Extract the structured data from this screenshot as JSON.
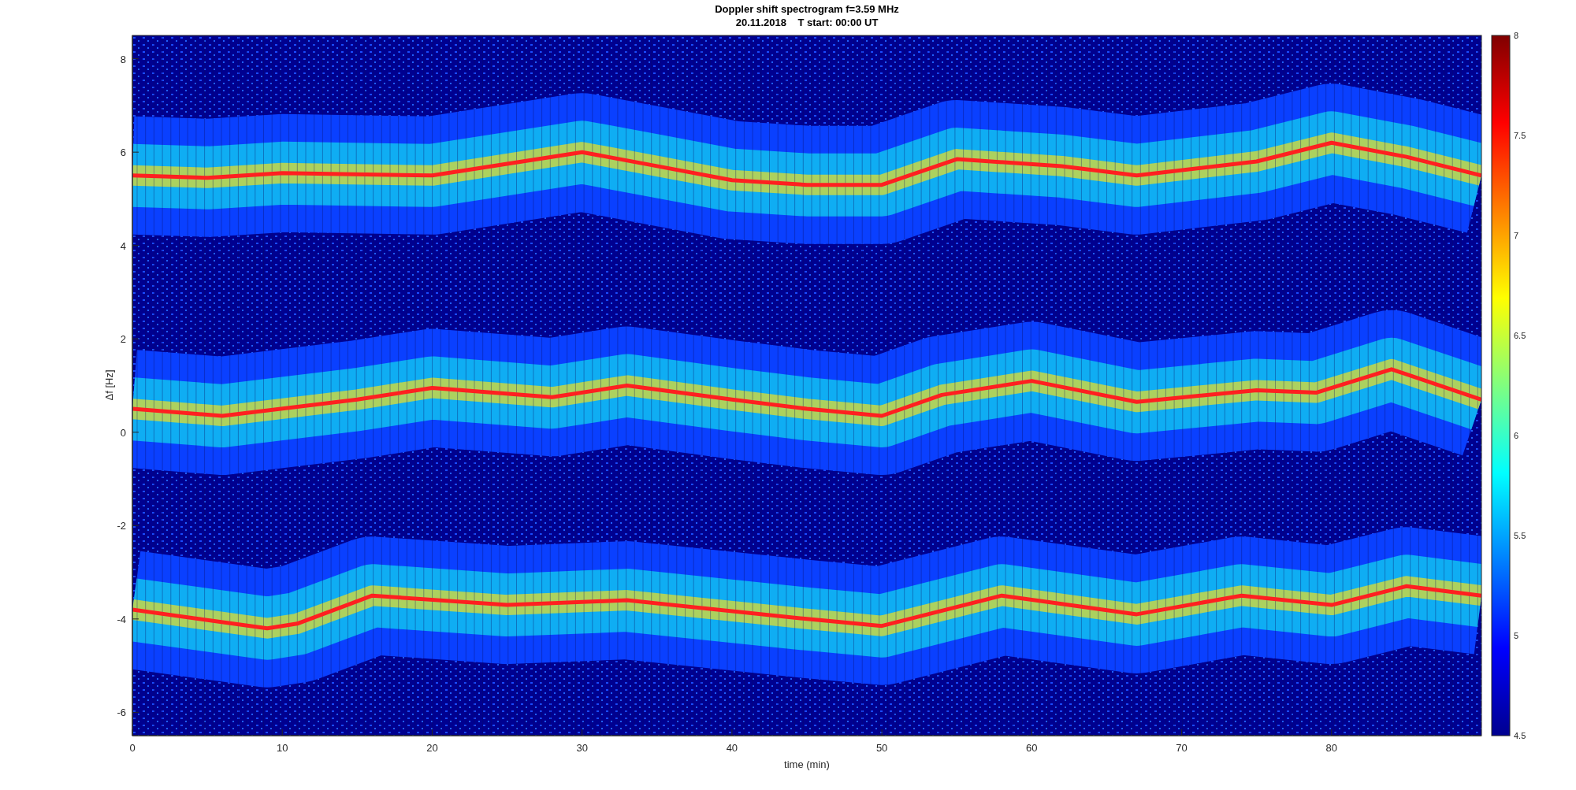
{
  "figure": {
    "title": [
      "Doppler shift spectrogram f=3.59 MHz",
      "20.11.2018    T start: 00:00 UT"
    ],
    "xlabel": "time (min)",
    "ylabel": "Δf [Hz]",
    "xticks": [
      "0",
      "10",
      "20",
      "30",
      "40",
      "50",
      "60",
      "70",
      "80"
    ],
    "yticks": [
      "8",
      "6",
      "4",
      "2",
      "0",
      "-2",
      "-4",
      "-6"
    ],
    "colorbar_ticks": [
      "8",
      "7.5",
      "7",
      "6.5",
      "6",
      "5.5",
      "5",
      "4.5"
    ]
  }
}
